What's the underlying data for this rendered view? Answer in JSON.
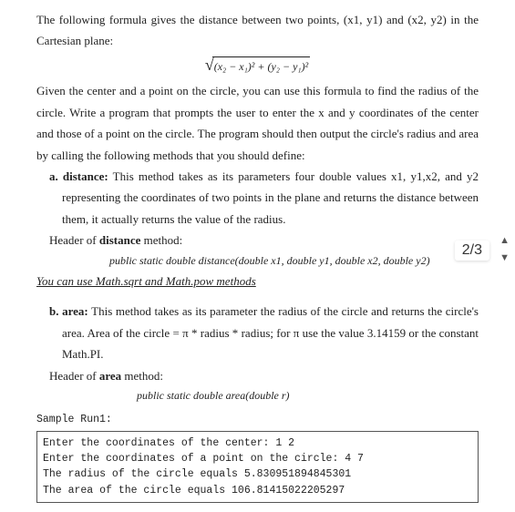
{
  "intro": {
    "p1": "The following formula gives the distance between two points, (x1, y1) and (x2, y2) in the Cartesian plane:",
    "formula_body": "(x₂ − x₁)² + (y₂ − y₁)²",
    "p2": "Given the center and a point on the circle, you can use this formula to find the radius of the circle. Write a program that prompts the user to enter the x and y coordinates of the center and those of a point on the circle. The program should then output the circle's radius and area by calling the following methods that you should define:"
  },
  "item_a": {
    "label": "a.",
    "title": "distance:",
    "desc1": " This method takes as its parameters four double values x1, y1,x2, and y2 representing the coordinates of two points in the plane and returns the distance between them, it actually returns the value of the radius.",
    "header_label": "Header of ",
    "header_name": "distance",
    "header_tail": " method:",
    "sig": "public static double distance(double x1, double y1, double x2, double y2)",
    "note_pre": "You can use Math.sqrt and Math.pow methods"
  },
  "item_b": {
    "label": "b.",
    "title": "area:",
    "desc1": " This method takes as its parameter the radius of the circle and returns the circle's area. Area of the circle = π * radius * radius; for π use the value 3.14159 or the constant Math.PI.",
    "header_label": "Header of ",
    "header_name": "area",
    "header_tail": " method:",
    "sig": "public static double area(double r)"
  },
  "sample": {
    "title": "Sample Run1:",
    "lines": [
      "Enter the coordinates of the center: 1 2",
      "Enter the coordinates of a point on the circle: 4 7",
      "The radius of the circle equals 5.830951894845301",
      "The area of the circle equals 106.81415022205297"
    ]
  },
  "page_indicator": "2/3",
  "arrows": {
    "up": "▲",
    "down": "▼"
  }
}
